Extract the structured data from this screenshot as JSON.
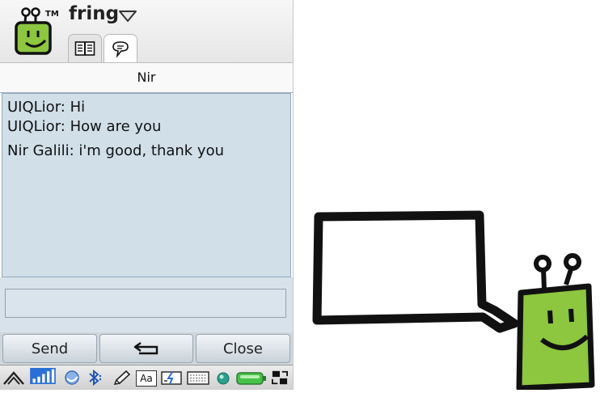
{
  "app": {
    "title": "fring",
    "trademark": "TM",
    "tabs": [
      {
        "name": "contacts-book",
        "icon": "book-icon"
      },
      {
        "name": "chat",
        "icon": "speech-bubble-icon"
      }
    ]
  },
  "chat": {
    "contact_name": "Nir",
    "messages": [
      {
        "text": "UIQLior: Hi"
      },
      {
        "text": "UIQLior: How are you"
      },
      {
        "text": "Nir Galili: i'm good, thank you"
      }
    ],
    "input_value": ""
  },
  "softkeys": {
    "send_label": "Send",
    "back_icon": "back-arrow-icon",
    "close_label": "Close"
  },
  "statusbar": {
    "font_icon_text": "Aa",
    "icons": [
      "menu-triangle-icon",
      "signal-strength-icon",
      "moon-icon",
      "bluetooth-icon",
      "pen-icon",
      "font-icon",
      "flash-icon",
      "keyboard-icon",
      "network-globe-icon",
      "battery-icon",
      "transfer-icon"
    ]
  },
  "colors": {
    "mascot_green": "#8dc63f",
    "message_bg": "#d1dfe9",
    "signal_blue": "#2a6fd6"
  }
}
